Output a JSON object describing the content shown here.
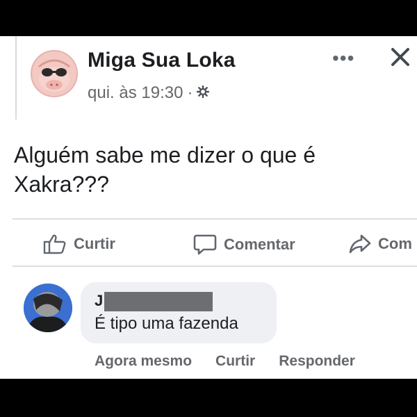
{
  "post": {
    "author": "Miga Sua Loka",
    "time": "qui. às 19:30",
    "separator": "·",
    "text": "Alguém sabe me dizer o que é Xakra???",
    "more_menu": "•••"
  },
  "actions": {
    "like": "Curtir",
    "comment": "Comentar",
    "share": "Com"
  },
  "comment": {
    "author_initial": "J",
    "text": "É tipo uma fazenda",
    "time": "Agora mesmo",
    "like": "Curtir",
    "reply": "Responder"
  },
  "icons": {
    "privacy": "gear-icon",
    "close": "close-icon",
    "like": "thumbs-up-icon",
    "comment": "speech-bubble-icon",
    "share": "share-arrow-icon"
  },
  "colors": {
    "background": "#000000",
    "card": "#ffffff",
    "text": "#1c1e21",
    "secondary": "#65676b",
    "bubble": "#eef0f3",
    "redaction": "#6d6e72"
  }
}
